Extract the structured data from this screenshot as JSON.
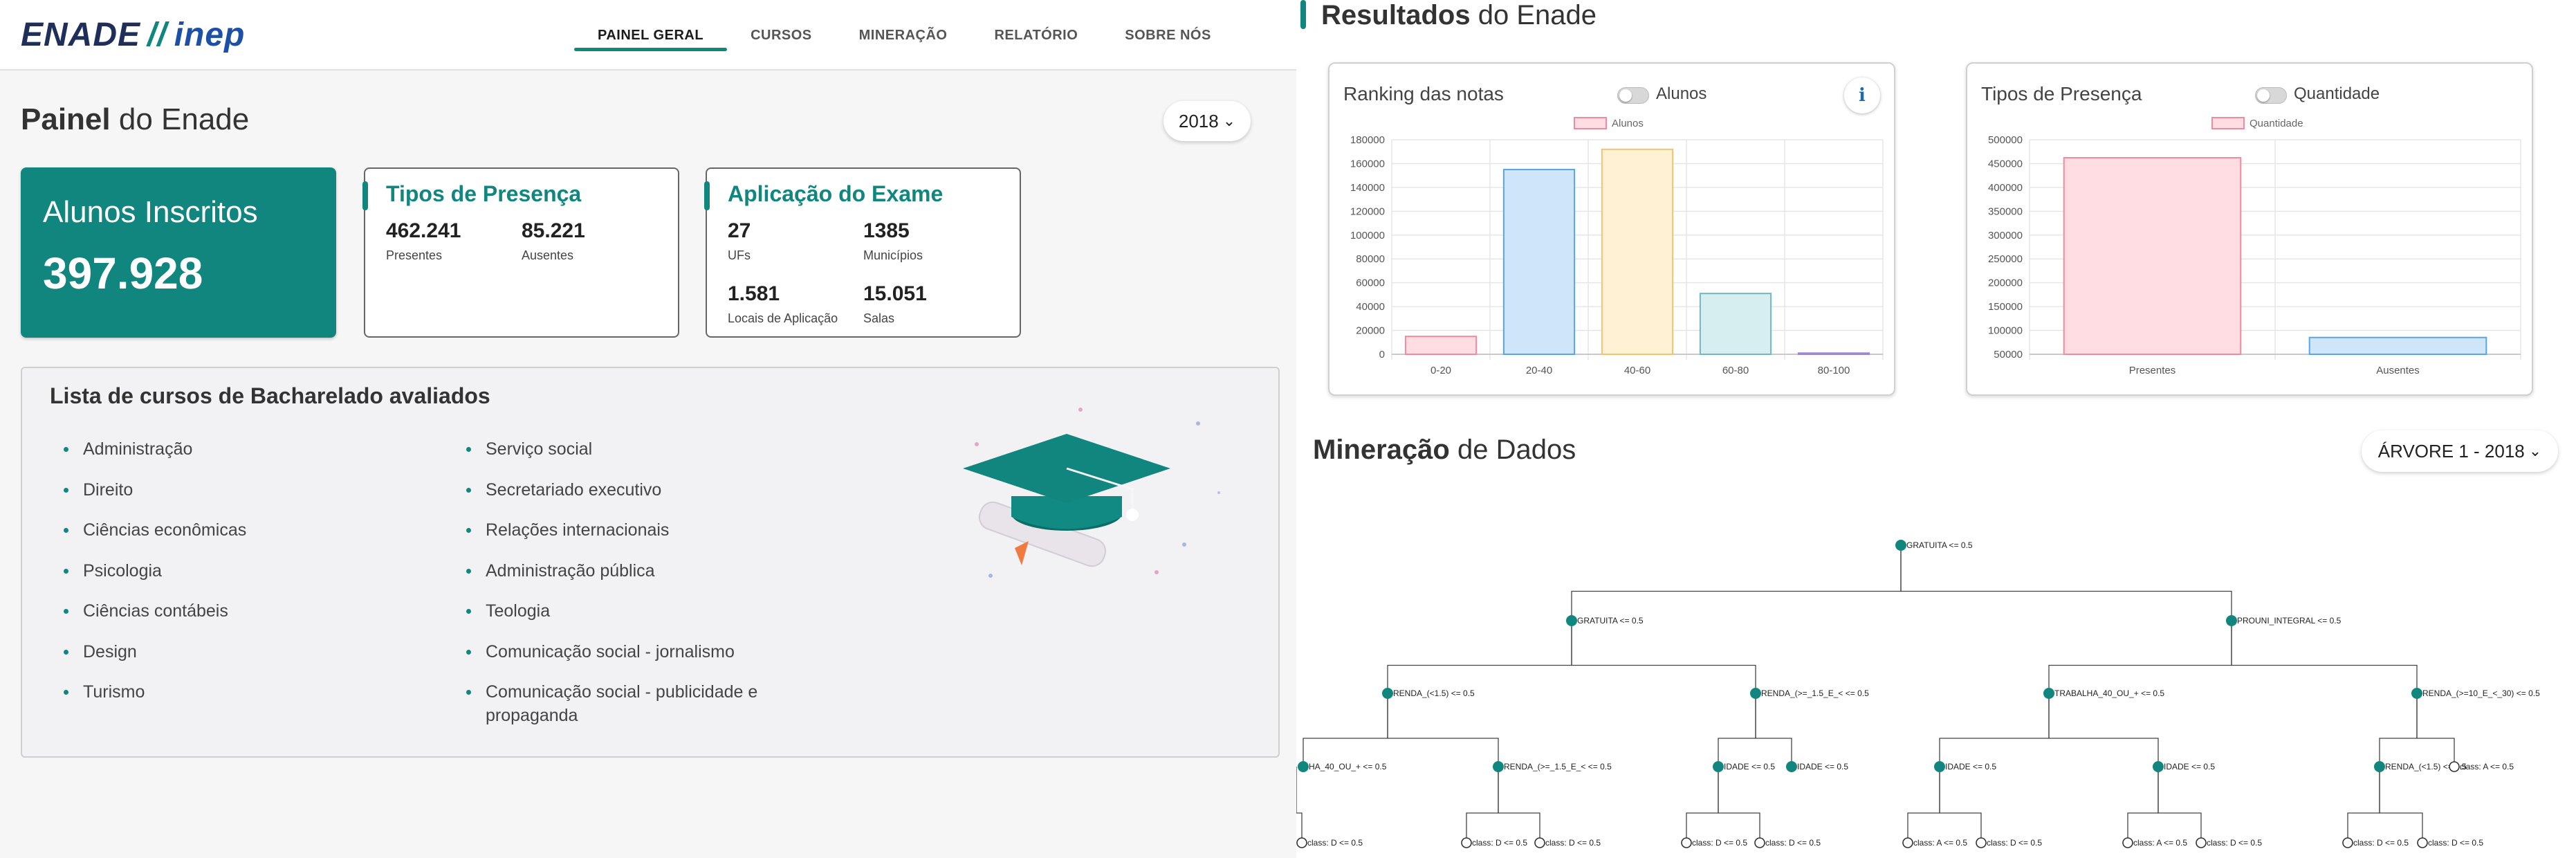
{
  "header": {
    "logo_enade": "ENADE",
    "logo_sep": "//",
    "logo_inep": "inep",
    "nav": [
      "PAINEL GERAL",
      "CURSOS",
      "MINERAÇÃO",
      "RELATÓRIO",
      "SOBRE NÓS"
    ],
    "active_nav": "PAINEL GERAL"
  },
  "painel": {
    "title_bold": "Painel",
    "title_rest": " do Enade",
    "year": "2018",
    "year_chevron": "⌄",
    "alunos_label": "Alunos Inscritos",
    "alunos_value": "397.928",
    "presenca": {
      "title": "Tipos de Presença",
      "items": [
        {
          "value": "462.241",
          "label": "Presentes"
        },
        {
          "value": "85.221",
          "label": "Ausentes"
        }
      ]
    },
    "aplicacao": {
      "title": "Aplicação do Exame",
      "items": [
        {
          "value": "27",
          "label": "UFs"
        },
        {
          "value": "1385",
          "label": "Municípios"
        },
        {
          "value": "1.581",
          "label": "Locais de Aplicação"
        },
        {
          "value": "15.051",
          "label": "Salas"
        }
      ]
    }
  },
  "cursos": {
    "title": "Lista de cursos de Bacharelado avaliados",
    "col1": [
      "Administração",
      "Direito",
      "Ciências econômicas",
      "Psicologia",
      "Ciências contábeis",
      "Design",
      "Turismo"
    ],
    "col2": [
      "Serviço social",
      "Secretariado executivo",
      "Relações internacionais",
      "Administração pública",
      "Teologia",
      "Comunicação social - jornalismo",
      "Comunicação social - publicidade e propaganda"
    ]
  },
  "resultados": {
    "title_bold": "Resultados",
    "title_rest": " do Enade"
  },
  "colors": {
    "teal": "#11867f",
    "pink": "#ffdde3",
    "blue": "#cfe6fa",
    "yellow": "#fff1d4",
    "cyan": "#d7eef0",
    "lavender": "#e9e3f8"
  },
  "chart_data": [
    {
      "type": "bar",
      "title": "Ranking das notas",
      "toggle_label": "Alunos",
      "legend": "Alunos",
      "info_label": "i",
      "categories": [
        "0-20",
        "20-40",
        "40-60",
        "60-80",
        "80-100"
      ],
      "values": [
        15000,
        155000,
        172000,
        51000,
        1000
      ],
      "colors": [
        "#ffdde3",
        "#cfe6fa",
        "#fff1d4",
        "#d7eef0",
        "#e9e3f8"
      ],
      "borders": [
        "#f08a9c",
        "#5aa4e6",
        "#f2c272",
        "#6fb8c2",
        "#9d86d8"
      ],
      "ylim": [
        0,
        180000
      ],
      "yticks": [
        0,
        20000,
        40000,
        60000,
        80000,
        100000,
        120000,
        140000,
        160000,
        180000
      ],
      "grid": true,
      "legend_position": "top"
    },
    {
      "type": "bar",
      "title": "Tipos de Presença",
      "toggle_label": "Quantidade",
      "legend": "Quantidade",
      "categories": [
        "Presentes",
        "Ausentes"
      ],
      "values": [
        462241,
        85221
      ],
      "colors": [
        "#ffdde3",
        "#cfe6fa"
      ],
      "borders": [
        "#f08a9c",
        "#5aa4e6"
      ],
      "ylim": [
        50000,
        500000
      ],
      "yticks": [
        50000,
        100000,
        150000,
        200000,
        250000,
        300000,
        350000,
        400000,
        450000,
        500000
      ],
      "grid": true,
      "legend_position": "top"
    }
  ],
  "mineracao": {
    "title_bold": "Mineração",
    "title_rest": " de Dados",
    "tree_selector": "ÁRVORE 1 - 2018",
    "chevron": "⌄"
  },
  "tree": {
    "root": "GRATUITA <= 0.5",
    "level1": [
      "GRATUITA <= 0.5",
      "PROUNI_INTEGRAL <= 0.5"
    ],
    "level2": [
      "RENDA_(<1.5) <= 0.5",
      "RENDA_(>=_1.5_E_< <= 0.5",
      "TRABALHA_40_OU_+ <= 0.5",
      "RENDA_(>=10_E_<_30) <= 0.5"
    ],
    "level3": [
      "HA_40_OU_+ <= 0.5",
      "RENDA_(>=_1.5_E_< <= 0.5",
      "IDADE <= 0.5",
      "IDADE <= 0.5",
      "IDADE <= 0.5",
      "IDADE <= 0.5",
      "RENDA_(<1.5) <= 0.5",
      "class: A <= 0.5"
    ],
    "leaves": [
      "class: D <= 0.5",
      "class: D <= 0.5",
      "class: D <= 0.5",
      "class: D <= 0.5",
      "class: D <= 0.5",
      "class: A <= 0.5",
      "class: D <= 0.5",
      "class: A <= 0.5",
      "class: D <= 0.5",
      "class: D <= 0.5",
      "class: D <= 0.5"
    ]
  }
}
